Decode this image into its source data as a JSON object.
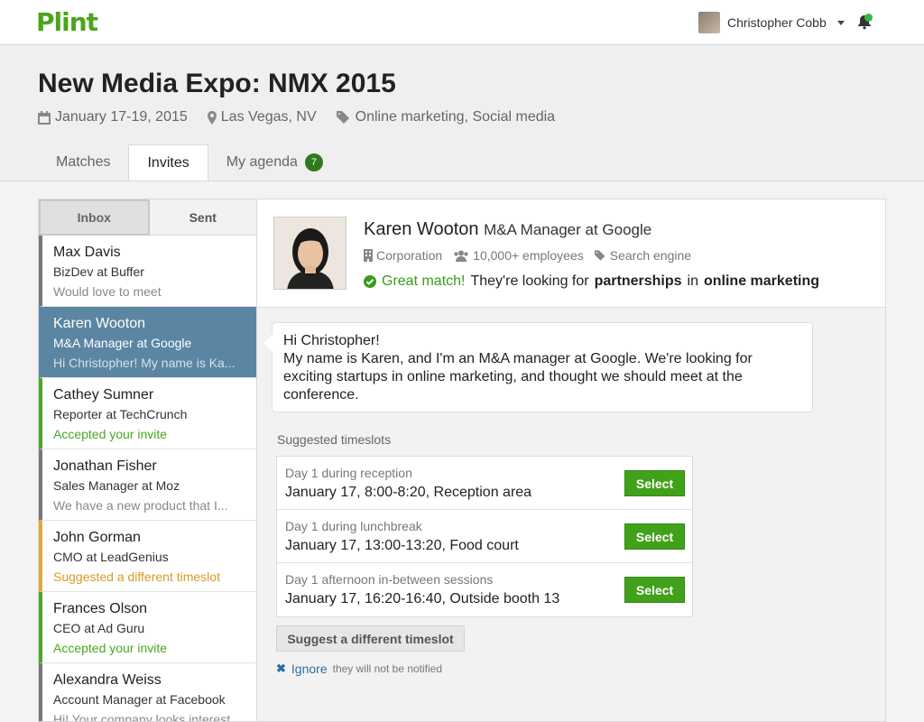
{
  "app": {
    "logo": "Plint"
  },
  "user": {
    "name": "Christopher Cobb"
  },
  "event": {
    "title": "New Media Expo: NMX 2015",
    "date": "January 17-19, 2015",
    "location": "Las Vegas, NV",
    "tags": "Online marketing, Social media"
  },
  "tabs": [
    {
      "label": "Matches"
    },
    {
      "label": "Invites"
    },
    {
      "label": "My agenda",
      "badge": "7"
    }
  ],
  "inbox": {
    "tabs": [
      "Inbox",
      "Sent"
    ],
    "messages": [
      {
        "name": "Max Davis",
        "role": "BizDev at Buffer",
        "note": "Would love to meet"
      },
      {
        "name": "Karen Wooton",
        "role": "M&A Manager at Google",
        "note": "Hi Christopher! My name is Ka..."
      },
      {
        "name": "Cathey Sumner",
        "role": "Reporter at TechCrunch",
        "note": "Accepted your invite"
      },
      {
        "name": "Jonathan Fisher",
        "role": "Sales Manager at Moz",
        "note": "We have a new product that I..."
      },
      {
        "name": "John Gorman",
        "role": "CMO at LeadGenius",
        "note": "Suggested a different timeslot"
      },
      {
        "name": "Frances Olson",
        "role": "CEO at Ad Guru",
        "note": "Accepted your invite"
      },
      {
        "name": "Alexandra Weiss",
        "role": "Account Manager at Facebook",
        "note": "Hi! Your company looks interestin..."
      }
    ]
  },
  "profile": {
    "name": "Karen Wooton",
    "title": "M&A Manager at Google",
    "type": "Corporation",
    "size": "10,000+ employees",
    "industry": "Search engine",
    "match_label": "Great match!",
    "match_text_1": "They're looking for",
    "match_bold_1": "partnerships",
    "match_text_2": "in",
    "match_bold_2": "online marketing"
  },
  "message": {
    "greeting": "Hi Christopher!",
    "body": "My name is Karen, and I'm an M&A manager at Google. We're looking for exciting startups in online marketing, and thought we should meet at the conference."
  },
  "timeslots": {
    "label": "Suggested timeslots",
    "select_label": "Select",
    "items": [
      {
        "when": "Day 1 during reception",
        "detail": "January 17, 8:00-8:20, Reception area"
      },
      {
        "when": "Day 1 during lunchbreak",
        "detail": "January 17, 13:00-13:20, Food court"
      },
      {
        "when": "Day 1 afternoon in-between sessions",
        "detail": "January 17, 16:20-16:40, Outside booth 13"
      }
    ],
    "suggest_label": "Suggest a different timeslot",
    "ignore_label": "Ignore",
    "ignore_hint": "they will not be notified"
  },
  "colors": {
    "brand": "#4aa51c",
    "selected": "#5b86a3",
    "accepted": "#48a822",
    "suggested": "#e0a83c"
  }
}
